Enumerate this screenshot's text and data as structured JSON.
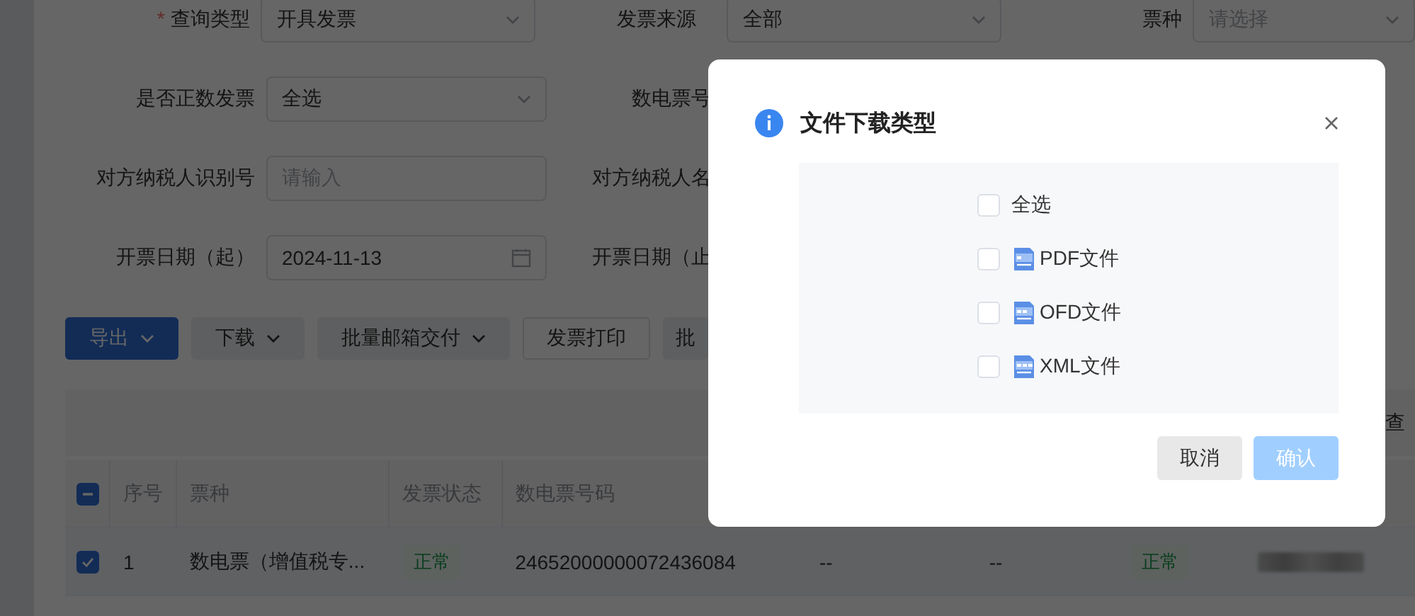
{
  "filters": [
    [
      {
        "label": "查询类型",
        "required_mark": "*",
        "kind": "select",
        "value": "开具发票"
      },
      {
        "label": "发票来源",
        "kind": "select",
        "value": "全部"
      },
      {
        "label": "票种",
        "kind": "select",
        "placeholder": "请选择"
      }
    ],
    [
      {
        "label": "是否正数发票",
        "kind": "select",
        "value": "全选"
      },
      {
        "label": "数电票号"
      }
    ],
    [
      {
        "label": "对方纳税人识别号",
        "kind": "input",
        "placeholder": "请输入"
      },
      {
        "label": "对方纳税人名"
      }
    ],
    [
      {
        "label": "开票日期（起）",
        "kind": "date",
        "value": "2024-11-13"
      },
      {
        "label": "开票日期（止"
      }
    ]
  ],
  "toolbar": [
    {
      "label": "导出",
      "kind": "primary",
      "dropdown": true
    },
    {
      "label": "下载",
      "kind": "default",
      "dropdown": true
    },
    {
      "label": "批量邮箱交付",
      "kind": "default",
      "dropdown": true
    },
    {
      "label": "发票打印",
      "kind": "plain",
      "dropdown": false
    },
    {
      "label": "批",
      "kind": "default",
      "dropdown": false
    }
  ],
  "table_toolbar": {
    "text": "查"
  },
  "table": {
    "select_all": {
      "indeterminate": true
    },
    "columns": [
      "序号",
      "票种",
      "发票状态",
      "数电票号码"
    ],
    "rows": [
      {
        "selected": true,
        "cells": [
          {
            "kind": "text",
            "text": "1"
          },
          {
            "kind": "text",
            "text": "数电票（增值税专..."
          },
          {
            "kind": "tag",
            "text": "正常"
          },
          {
            "kind": "text",
            "text": "24652000000072436084"
          },
          {
            "kind": "text",
            "text": "--"
          },
          {
            "kind": "text",
            "text": "--"
          },
          {
            "kind": "tag",
            "text": "正常"
          },
          {
            "kind": "blurred"
          }
        ]
      }
    ]
  },
  "dialog": {
    "title": "文件下载类型",
    "options": [
      {
        "label": "全选",
        "kind": "all",
        "checked": false
      },
      {
        "label": "PDF文件",
        "kind": "pdf",
        "checked": false
      },
      {
        "label": "OFD文件",
        "kind": "ofd",
        "checked": false
      },
      {
        "label": "XML文件",
        "kind": "xml",
        "checked": false
      }
    ],
    "buttons": [
      {
        "label": "取消",
        "kind": "default",
        "disabled": false
      },
      {
        "label": "确认",
        "kind": "primary",
        "disabled": true
      }
    ]
  }
}
